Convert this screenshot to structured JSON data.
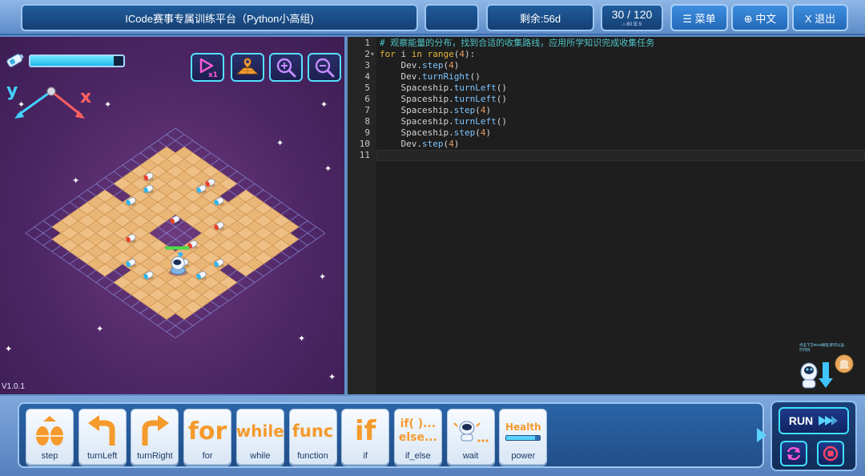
{
  "header": {
    "title": "ICode赛事专属训练平台（Python小高组)",
    "remaining": "剩余:56d",
    "progress": "30 / 120",
    "progress_sub": "⌂ 80    ☰ 9",
    "menu_label": "☰ 菜单",
    "lang_label": "⊕ 中文",
    "exit_label": "X 退出"
  },
  "game": {
    "energy_level": 0.9,
    "version": "V1.0.1",
    "axis_y": "y",
    "axis_x": "x",
    "tools": [
      {
        "name": "speed-icon"
      },
      {
        "name": "map-icon"
      },
      {
        "name": "zoom-in-icon"
      },
      {
        "name": "zoom-out-icon"
      }
    ]
  },
  "editor": {
    "lines": [
      "# 观察能量的分布，找到合适的收集路线，应用所学知识完成收集任务",
      "for i in range(4):",
      "    Dev.step(4)",
      "    Dev.turnRight()",
      "    Spaceship.turnLeft()",
      "    Spaceship.turnLeft()",
      "    Spaceship.step(4)",
      "    Spaceship.turnLeft()",
      "    Spaceship.step(4)",
      "    Dev.step(4)",
      ""
    ],
    "current_line": 11,
    "hint_text": "点击下方RUN按钮 即可以运行代码"
  },
  "blocks": [
    {
      "label": "step",
      "glyph": "step"
    },
    {
      "label": "turnLeft",
      "glyph": "turnLeft"
    },
    {
      "label": "turnRight",
      "glyph": "turnRight"
    },
    {
      "label": "for",
      "glyph": "for"
    },
    {
      "label": "while",
      "glyph": "while"
    },
    {
      "label": "function",
      "glyph": "func"
    },
    {
      "label": "if",
      "glyph": "if"
    },
    {
      "label": "if_else",
      "glyph": "if( )...\nelse..."
    },
    {
      "label": "wait",
      "glyph": "wait"
    },
    {
      "label": "power",
      "glyph": "Health"
    }
  ],
  "run": {
    "run_label": "RUN"
  }
}
